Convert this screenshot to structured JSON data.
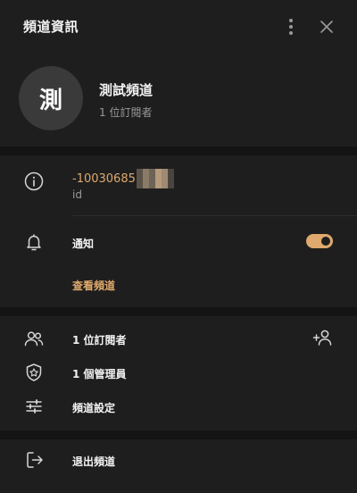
{
  "header": {
    "title": "頻道資訊",
    "more_icon": "kebab-vertical-icon",
    "close_icon": "close-x-icon"
  },
  "channel": {
    "avatar_letter": "測",
    "name": "測試頻道",
    "subscribers": "1 位訂閱者"
  },
  "info": {
    "id_value": "-10030685",
    "id_caption": "id",
    "icon": "info-circle-icon"
  },
  "notifications": {
    "label": "通知",
    "enabled": true,
    "icon": "bell-icon"
  },
  "view_channel": {
    "label": "查看頻道"
  },
  "members": {
    "subscribers_label": "1 位訂閱者",
    "admins_label": "1 個管理員",
    "settings_label": "頻道設定",
    "add_icon": "add-user-icon"
  },
  "leave": {
    "label": "退出頻道",
    "icon": "logout-icon"
  },
  "colors": {
    "accent": "#e0a96d",
    "background": "#1e1e1e",
    "separator": "#141414",
    "muted_text": "#9a9a9a"
  }
}
